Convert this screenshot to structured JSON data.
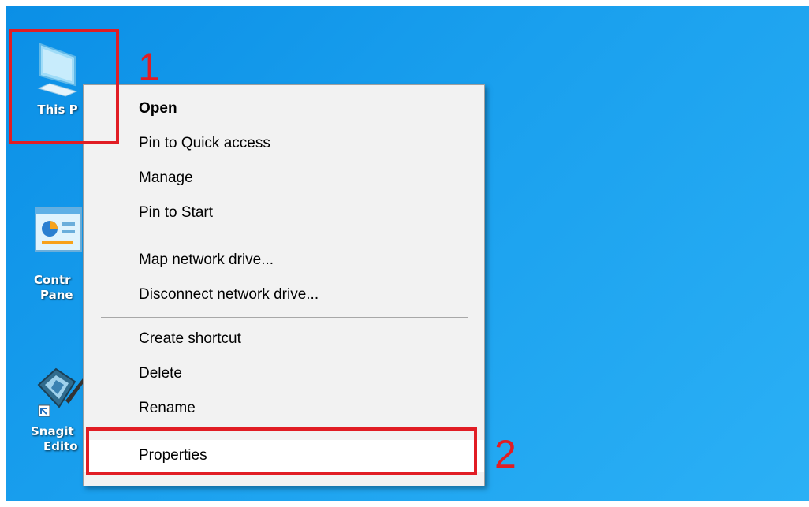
{
  "desktop": {
    "icons": [
      {
        "name": "this-pc",
        "label": "This P",
        "icon": "computer-icon"
      },
      {
        "name": "control-panel",
        "label_lines": [
          "Contr",
          "Pane"
        ],
        "icon": "control-panel-icon"
      },
      {
        "name": "snagit-editor",
        "label_lines": [
          "Snagit",
          "Edito"
        ],
        "icon": "snagit-icon"
      }
    ]
  },
  "context_menu": {
    "groups": [
      [
        {
          "label": "Open",
          "bold": true
        },
        {
          "label": "Pin to Quick access"
        },
        {
          "label": "Manage"
        },
        {
          "label": "Pin to Start"
        }
      ],
      [
        {
          "label": "Map network drive..."
        },
        {
          "label": "Disconnect network drive..."
        }
      ],
      [
        {
          "label": "Create shortcut"
        },
        {
          "label": "Delete"
        },
        {
          "label": "Rename"
        }
      ],
      [
        {
          "label": "Properties",
          "highlighted": true
        }
      ]
    ]
  },
  "annotations": [
    {
      "number": "1",
      "color": "#e11d24"
    },
    {
      "number": "2",
      "color": "#e11d24"
    }
  ],
  "colors": {
    "desktop_bg": "#1aa0ee",
    "menu_bg": "#f2f2f2",
    "annotation": "#e11d24"
  }
}
